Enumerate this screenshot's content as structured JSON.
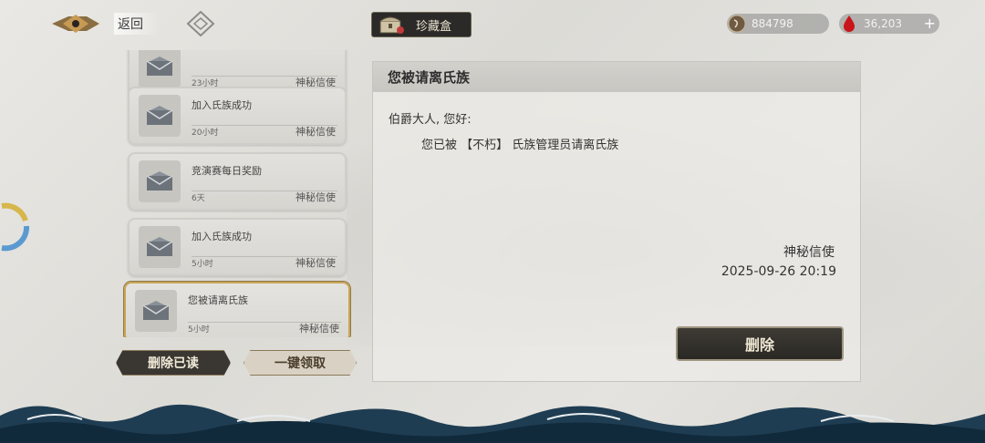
{
  "topbar": {
    "back_label": "返回",
    "treasure_label": "珍藏盒",
    "coin_value": "884798",
    "blood_value": "36,203",
    "plus": "+"
  },
  "mail_list": [
    {
      "title": "",
      "time": "23小时",
      "sender": "神秘信使",
      "selected": false,
      "partial": true
    },
    {
      "title": "加入氏族成功",
      "time": "20小时",
      "sender": "神秘信使",
      "selected": false
    },
    {
      "title": "竞演赛每日奖励",
      "time": "6天",
      "sender": "神秘信使",
      "selected": false
    },
    {
      "title": "加入氏族成功",
      "time": "5小时",
      "sender": "神秘信使",
      "selected": false
    },
    {
      "title": "您被请离氏族",
      "time": "5小时",
      "sender": "神秘信使",
      "selected": true
    }
  ],
  "actions": {
    "delete_read": "删除已读",
    "claim_all": "一键领取"
  },
  "detail": {
    "title": "您被请离氏族",
    "greeting": "伯爵大人, 您好:",
    "body": "您已被 【不朽】 氏族管理员请离氏族",
    "signature": "神秘信使",
    "date": "2025-09-26   20:19",
    "delete_label": "删除"
  },
  "colors": {
    "accent_gold": "#c8a456",
    "dark_button": "#2a2824",
    "ring_blue": "#5b9ad0",
    "ring_yellow": "#d7b64b"
  }
}
